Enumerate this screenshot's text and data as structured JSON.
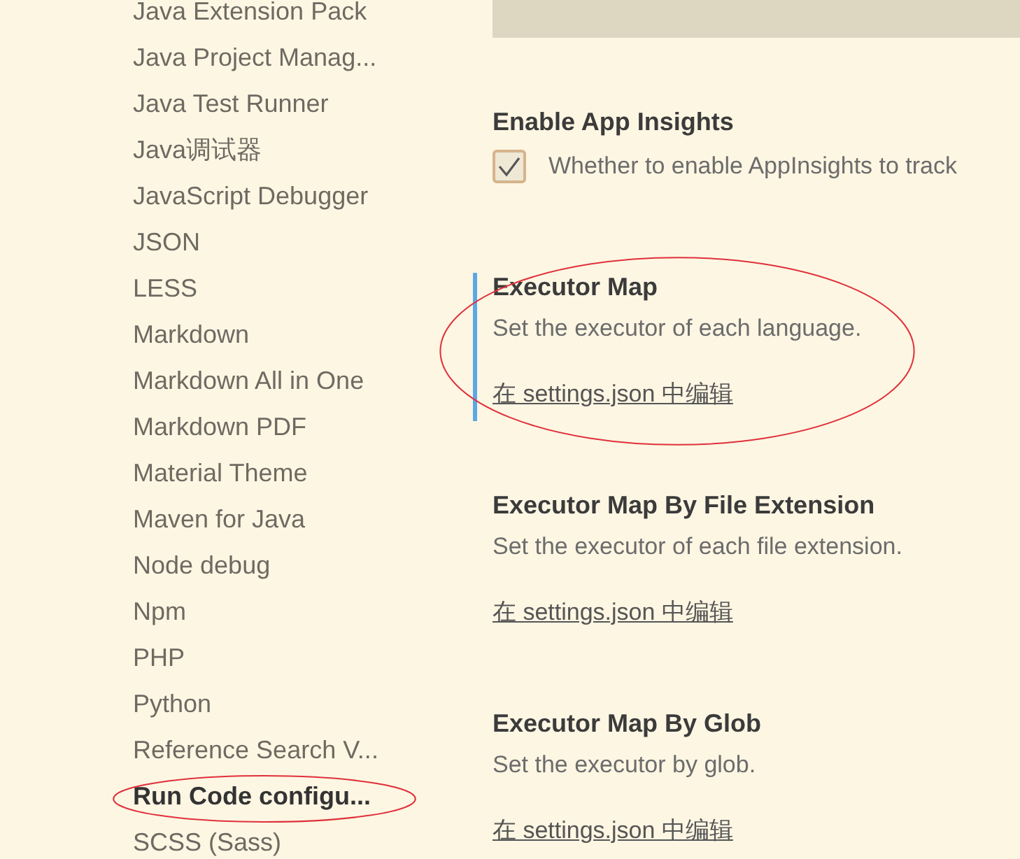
{
  "sidebar": {
    "items": [
      {
        "label": "Java Extension Pack",
        "selected": false,
        "highlighted": false
      },
      {
        "label": "Java Project Manag...",
        "selected": false,
        "highlighted": false
      },
      {
        "label": "Java Test Runner",
        "selected": false,
        "highlighted": false
      },
      {
        "label": "Java调试器",
        "selected": false,
        "highlighted": false
      },
      {
        "label": "JavaScript Debugger",
        "selected": false,
        "highlighted": false
      },
      {
        "label": "JSON",
        "selected": false,
        "highlighted": false
      },
      {
        "label": "LESS",
        "selected": false,
        "highlighted": false
      },
      {
        "label": "Markdown",
        "selected": false,
        "highlighted": false
      },
      {
        "label": "Markdown All in One",
        "selected": false,
        "highlighted": false
      },
      {
        "label": "Markdown PDF",
        "selected": false,
        "highlighted": false
      },
      {
        "label": "Material Theme",
        "selected": false,
        "highlighted": false
      },
      {
        "label": "Maven for Java",
        "selected": false,
        "highlighted": false
      },
      {
        "label": "Node debug",
        "selected": false,
        "highlighted": false
      },
      {
        "label": "Npm",
        "selected": false,
        "highlighted": false
      },
      {
        "label": "PHP",
        "selected": false,
        "highlighted": false
      },
      {
        "label": "Python",
        "selected": false,
        "highlighted": false
      },
      {
        "label": "Reference Search V...",
        "selected": false,
        "highlighted": false
      },
      {
        "label": "Run Code configu...",
        "selected": true,
        "highlighted": true
      },
      {
        "label": "SCSS (Sass)",
        "selected": false,
        "highlighted": false
      }
    ]
  },
  "settings": [
    {
      "kind": "checkbox",
      "title": "Enable App Insights",
      "description": "Whether to enable AppInsights to track",
      "checked": true,
      "focused": false,
      "highlighted": false
    },
    {
      "kind": "json",
      "title": "Executor Map",
      "description": "Set the executor of each language.",
      "link": "在 settings.json 中编辑",
      "focused": true,
      "highlighted": true
    },
    {
      "kind": "json",
      "title": "Executor Map By File Extension",
      "description": "Set the executor of each file extension.",
      "link": "在 settings.json 中编辑",
      "focused": false,
      "highlighted": false
    },
    {
      "kind": "json",
      "title": "Executor Map By Glob",
      "description": "Set the executor by glob.",
      "link": "在 settings.json 中编辑",
      "focused": false,
      "highlighted": false
    }
  ]
}
